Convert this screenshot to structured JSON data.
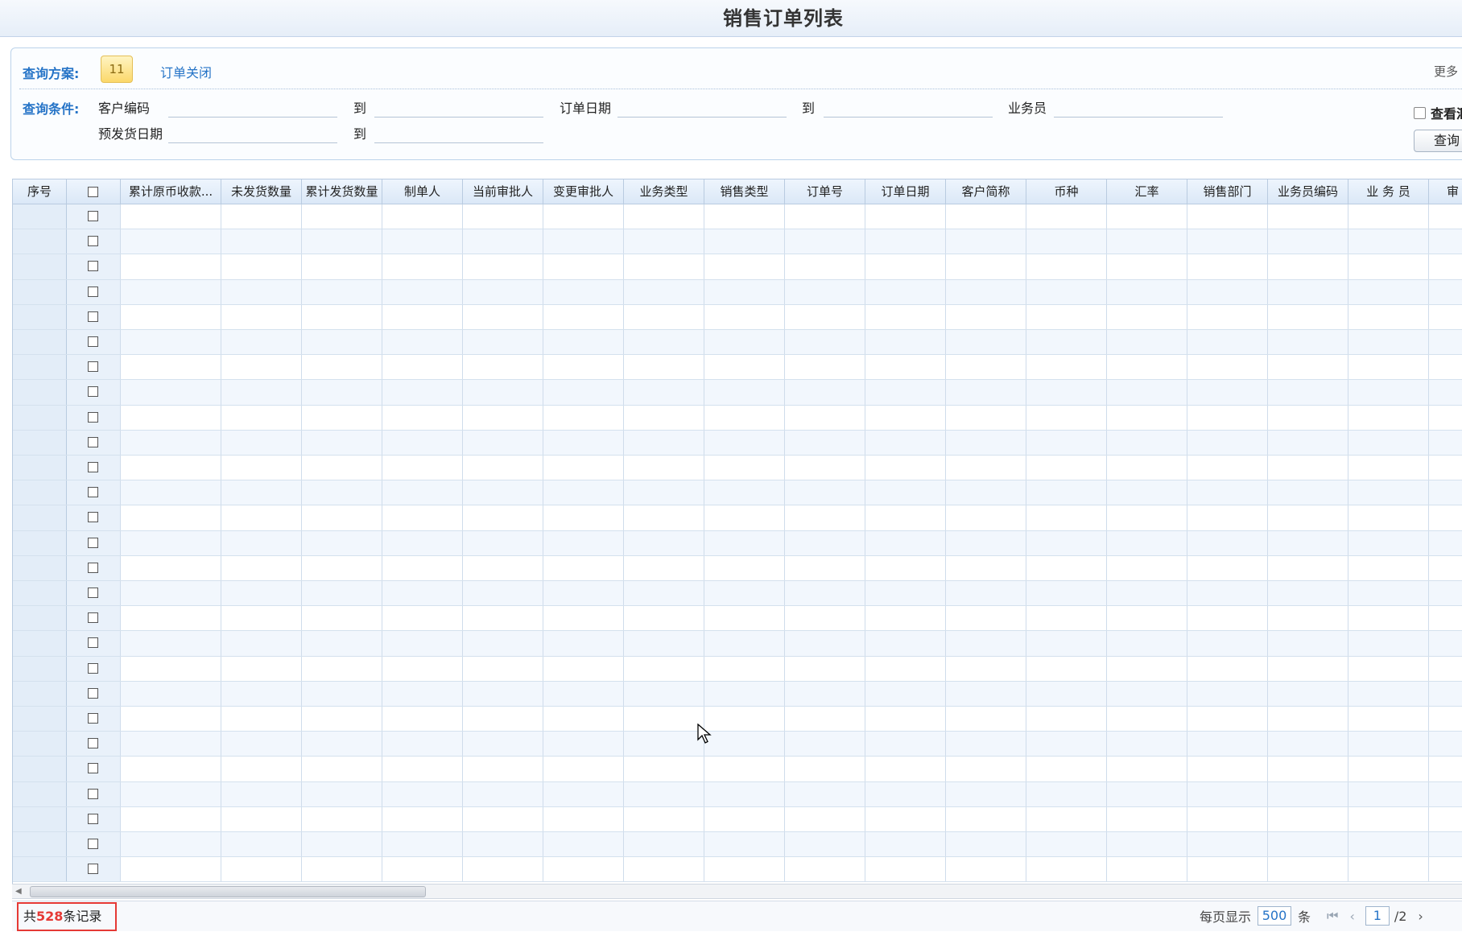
{
  "title": "销售订单列表",
  "query": {
    "plan_label": "查询方案:",
    "plan_chip": "11",
    "plan_link": "订单关闭",
    "more_link": "更多",
    "condition_label": "查询条件:",
    "fields": {
      "customer_code": "客户编码",
      "to": "到",
      "order_date": "订单日期",
      "salesperson": "业务员",
      "pre_ship_date": "预发货日期"
    },
    "summary_checkbox": "查看汇",
    "search_button": "查询"
  },
  "grid": {
    "columns": [
      "序号",
      "",
      "累计原币收款...",
      "未发货数量",
      "累计发货数量",
      "制单人",
      "当前审批人",
      "变更审批人",
      "业务类型",
      "销售类型",
      "订单号",
      "订单日期",
      "客户简称",
      "币种",
      "汇率",
      "销售部门",
      "业务员编码",
      "业 务 员",
      "审"
    ],
    "row_count": 27
  },
  "footer": {
    "count_prefix": "共",
    "count_value": "528",
    "count_suffix": "条记录",
    "per_page_label": "每页显示",
    "per_page_value": "500",
    "per_page_unit": "条",
    "first_icon": "first-page-icon",
    "prev_icon": "prev-page-icon",
    "current_page": "1",
    "total_pages": "/2",
    "next_icon": "next-page-icon"
  },
  "colors": {
    "accent": "#2674c7",
    "highlight": "#e53935",
    "header_bg": "#dbe8f7"
  }
}
